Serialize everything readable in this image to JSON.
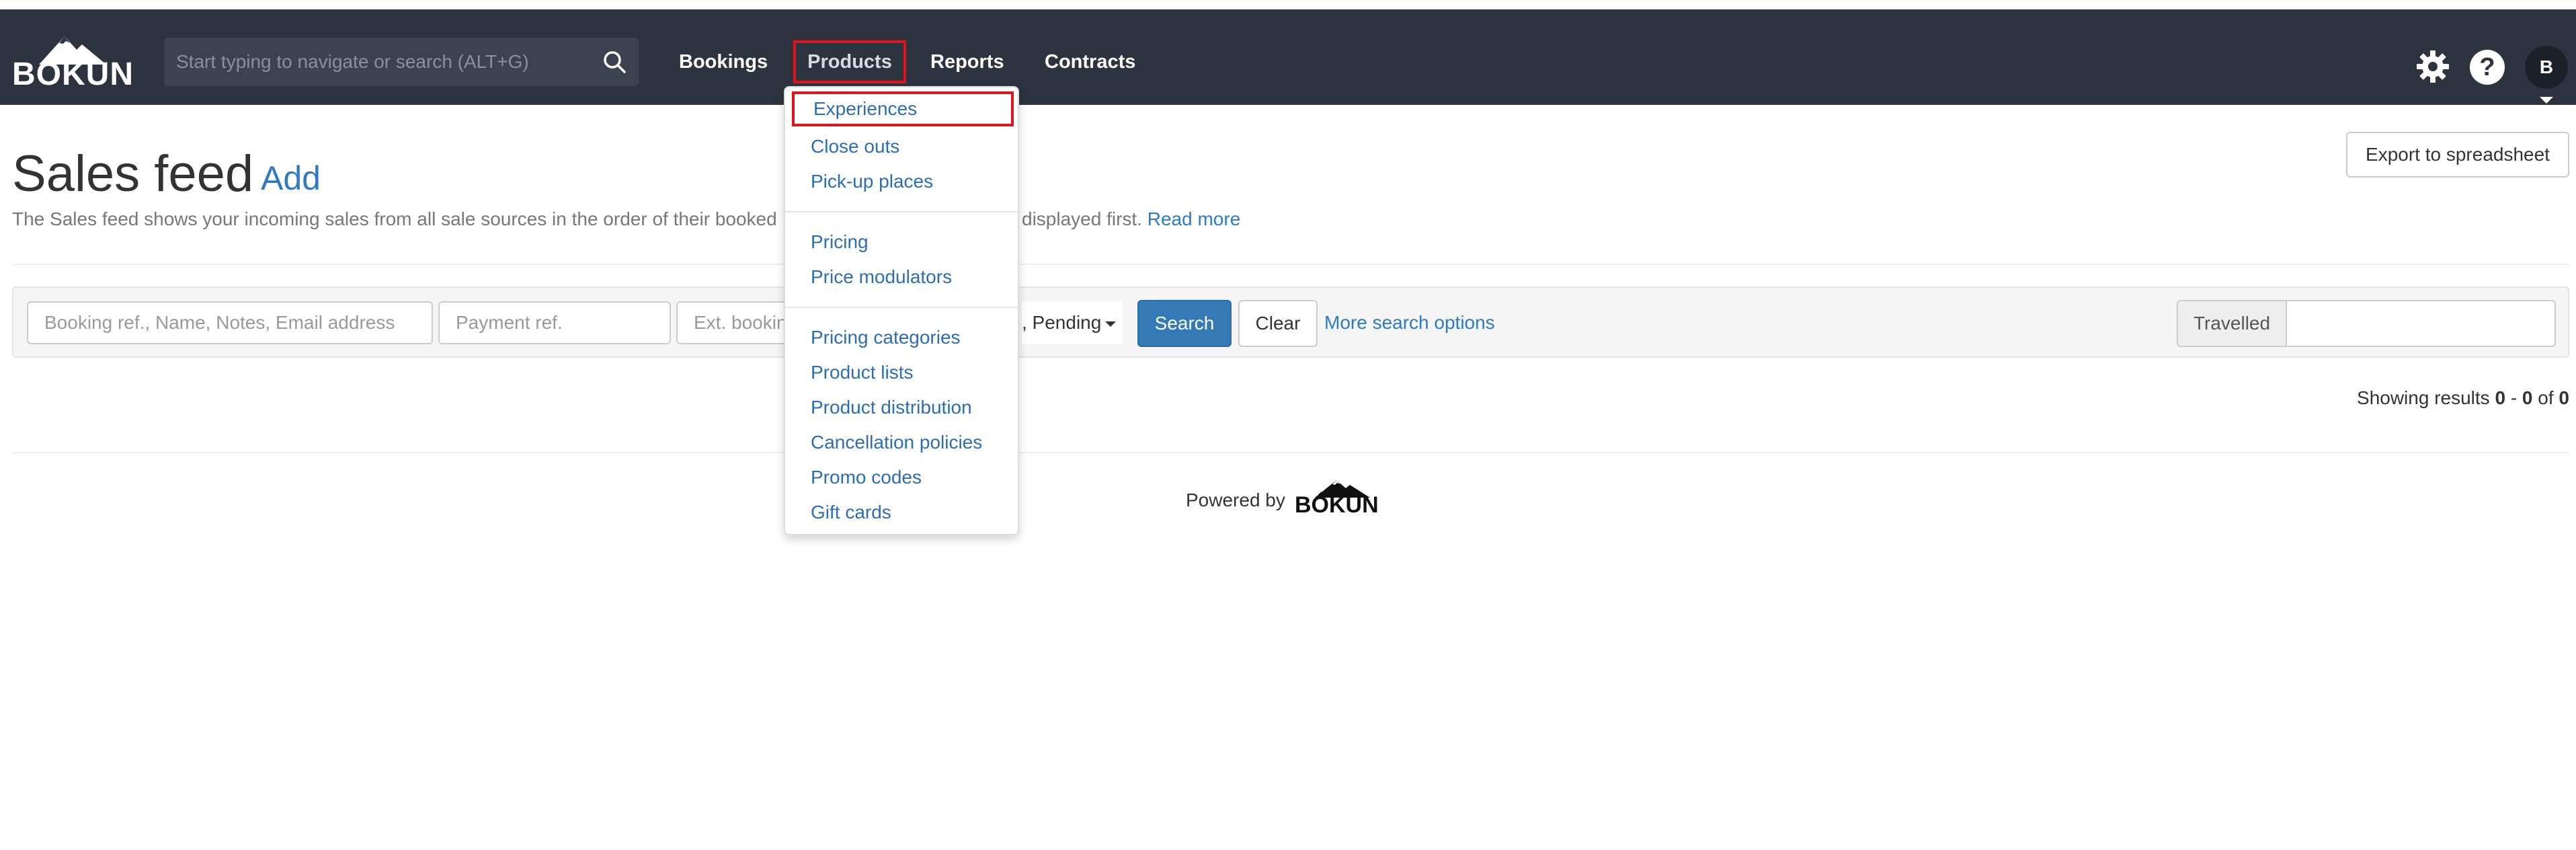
{
  "navbar": {
    "logo_text": "BÓKUN",
    "search_placeholder": "Start typing to navigate or search (ALT+G)",
    "items": [
      "Bookings",
      "Products",
      "Reports",
      "Contracts"
    ],
    "avatar_initial": "B",
    "help_glyph": "?",
    "icons": [
      "search-icon",
      "gear-icon",
      "help-icon",
      "chevron-down-icon"
    ]
  },
  "products_menu": {
    "group1": [
      "Experiences",
      "Close outs",
      "Pick-up places"
    ],
    "group2": [
      "Pricing",
      "Price modulators"
    ],
    "group3": [
      "Pricing categories",
      "Product lists",
      "Product distribution",
      "Cancellation policies",
      "Promo codes",
      "Gift cards"
    ]
  },
  "header": {
    "title": "Sales feed",
    "add_link": "Add",
    "description_start": "The Sales feed shows your incoming sales from all sale sources in the order of their booked",
    "description_end": "displayed first.",
    "read_more": "Read more",
    "export_button": "Export to spreadsheet"
  },
  "filters": {
    "booking_placeholder": "Booking ref., Name, Notes, Email address",
    "payment_placeholder": "Payment ref.",
    "ext_placeholder": "Ext. booking",
    "status_value": ", Pending",
    "search_button": "Search",
    "clear_button": "Clear",
    "more_options": "More search options",
    "travelled_label": "Travelled"
  },
  "results": {
    "prefix": "Showing results",
    "from": "0",
    "dash": "-",
    "to": "0",
    "of_label": "of",
    "total": "0"
  },
  "footer": {
    "powered_by": "Powered by",
    "logo_text": "BÓKUN"
  },
  "colors": {
    "navbar_bg": "#2d3440",
    "link": "#2c7bc3",
    "primary_button": "#337ab7",
    "highlight_outline": "#e0141c"
  }
}
